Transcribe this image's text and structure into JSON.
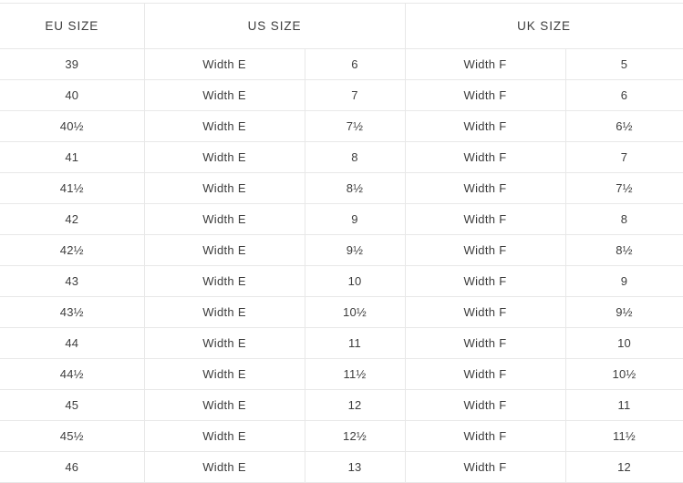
{
  "table": {
    "headers": [
      {
        "label": "EU SIZE",
        "colspan": 1
      },
      {
        "label": "US SIZE",
        "colspan": 2
      },
      {
        "label": "UK SIZE",
        "colspan": 2
      }
    ],
    "column_keys": [
      "eu_size",
      "us_width",
      "us_size",
      "uk_width",
      "uk_size"
    ],
    "rows": [
      {
        "eu_size": "39",
        "us_width": "Width E",
        "us_size": "6",
        "uk_width": "Width F",
        "uk_size": "5"
      },
      {
        "eu_size": "40",
        "us_width": "Width E",
        "us_size": "7",
        "uk_width": "Width F",
        "uk_size": "6"
      },
      {
        "eu_size": "40½",
        "us_width": "Width E",
        "us_size": "7½",
        "uk_width": "Width F",
        "uk_size": "6½"
      },
      {
        "eu_size": "41",
        "us_width": "Width E",
        "us_size": "8",
        "uk_width": "Width F",
        "uk_size": "7"
      },
      {
        "eu_size": "41½",
        "us_width": "Width E",
        "us_size": "8½",
        "uk_width": "Width F",
        "uk_size": "7½"
      },
      {
        "eu_size": "42",
        "us_width": "Width E",
        "us_size": "9",
        "uk_width": "Width F",
        "uk_size": "8"
      },
      {
        "eu_size": "42½",
        "us_width": "Width E",
        "us_size": "9½",
        "uk_width": "Width F",
        "uk_size": "8½"
      },
      {
        "eu_size": "43",
        "us_width": "Width E",
        "us_size": "10",
        "uk_width": "Width F",
        "uk_size": "9"
      },
      {
        "eu_size": "43½",
        "us_width": "Width E",
        "us_size": "10½",
        "uk_width": "Width F",
        "uk_size": "9½"
      },
      {
        "eu_size": "44",
        "us_width": "Width E",
        "us_size": "11",
        "uk_width": "Width F",
        "uk_size": "10"
      },
      {
        "eu_size": "44½",
        "us_width": "Width E",
        "us_size": "11½",
        "uk_width": "Width F",
        "uk_size": "10½"
      },
      {
        "eu_size": "45",
        "us_width": "Width E",
        "us_size": "12",
        "uk_width": "Width F",
        "uk_size": "11"
      },
      {
        "eu_size": "45½",
        "us_width": "Width E",
        "us_size": "12½",
        "uk_width": "Width F",
        "uk_size": "11½"
      },
      {
        "eu_size": "46",
        "us_width": "Width E",
        "us_size": "13",
        "uk_width": "Width F",
        "uk_size": "12"
      }
    ]
  },
  "colors": {
    "text": "#3d3d3d",
    "border": "#e8e8e8",
    "background": "#ffffff"
  }
}
